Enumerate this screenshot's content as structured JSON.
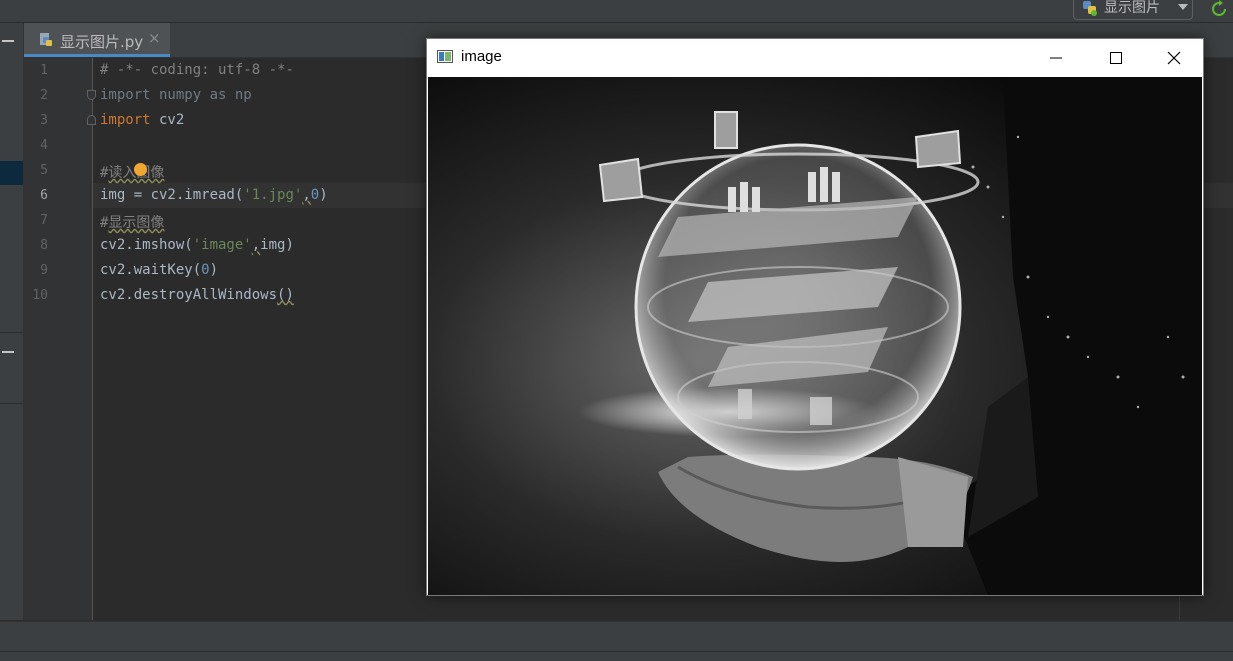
{
  "toolbar": {
    "run_config_label": "显示图片"
  },
  "editor_tab": {
    "filename": "显示图片.py",
    "close_glyph": "×"
  },
  "line_numbers": [
    "1",
    "2",
    "3",
    "4",
    "5",
    "6",
    "7",
    "8",
    "9",
    "10"
  ],
  "code": {
    "l1": "# -*- coding: utf-8 -*-",
    "l2_kw": "import",
    "l2_rest": " numpy as np",
    "l3_kw": "import",
    "l3_rest": " cv2",
    "l5_hash": "#",
    "l5_text": "读入图像",
    "l6_a": "img = cv2.imread(",
    "l6_str": "'1.jpg'",
    "l6_comma": ",",
    "l6_num": "0",
    "l6_end": ")",
    "l7_hash": "#",
    "l7_text": "显示图像",
    "l8_a": "cv2.imshow(",
    "l8_str": "'image'",
    "l8_comma": ",",
    "l8_end": "img)",
    "l9_a": "cv2.waitKey(",
    "l9_num": "0",
    "l9_end": ")",
    "l10": "cv2.destroyAllWindows",
    "l10_parens": "()"
  },
  "image_window": {
    "title": "image",
    "minimize_icon": "minimize-icon",
    "maximize_icon": "maximize-icon",
    "close_icon": "close-icon",
    "image_description_icon": "grayscale-photo"
  },
  "colors": {
    "editor_bg": "#2b2b2b",
    "keyword": "#cc7832",
    "string": "#6a8759",
    "number": "#6897bb",
    "comment": "#808080",
    "tab_underline": "#4a88c7"
  }
}
